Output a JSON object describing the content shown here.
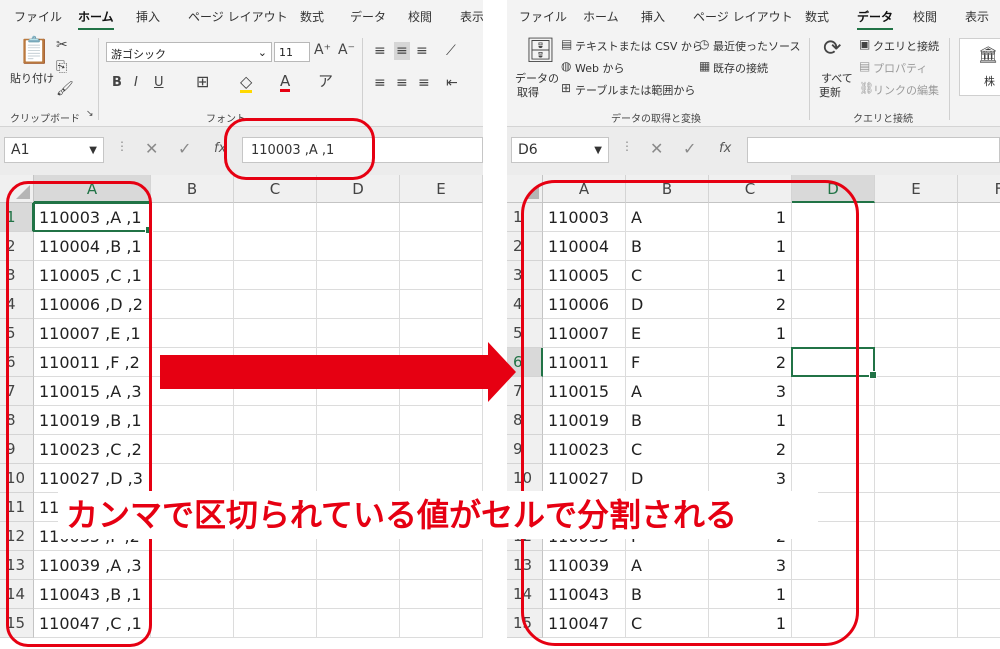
{
  "left": {
    "tabs": [
      "ファイル",
      "ホーム",
      "挿入",
      "ページ レイアウト",
      "数式",
      "データ",
      "校閲",
      "表示"
    ],
    "active_tab": "ホーム",
    "clipboard": {
      "paste": "貼り付け",
      "group": "クリップボード"
    },
    "font": {
      "name": "游ゴシック",
      "size": "11",
      "bold": "B",
      "italic": "I",
      "underline": "U",
      "group": "フォント"
    },
    "name_box": "A1",
    "formula": "110003 ,A ,1",
    "columns": [
      "A",
      "B",
      "C",
      "D",
      "E"
    ],
    "rows": [
      {
        "n": "1",
        "a": "110003 ,A ,1"
      },
      {
        "n": "2",
        "a": "110004 ,B ,1"
      },
      {
        "n": "3",
        "a": "110005 ,C ,1"
      },
      {
        "n": "4",
        "a": "110006 ,D ,2"
      },
      {
        "n": "5",
        "a": "110007 ,E ,1"
      },
      {
        "n": "6",
        "a": "110011 ,F ,2"
      },
      {
        "n": "7",
        "a": "110015 ,A ,3"
      },
      {
        "n": "8",
        "a": "110019 ,B ,1"
      },
      {
        "n": "9",
        "a": "110023 ,C ,2"
      },
      {
        "n": "10",
        "a": "110027 ,D ,3"
      },
      {
        "n": "11",
        "a": "11"
      },
      {
        "n": "12",
        "a": "110035 ,F ,2"
      },
      {
        "n": "13",
        "a": "110039 ,A ,3"
      },
      {
        "n": "14",
        "a": "110043 ,B ,1"
      },
      {
        "n": "15",
        "a": "110047 ,C ,1"
      }
    ]
  },
  "right": {
    "tabs": [
      "ファイル",
      "ホーム",
      "挿入",
      "ページ レイアウト",
      "数式",
      "データ",
      "校閲",
      "表示"
    ],
    "active_tab": "データ",
    "get_data": "データの\n取得",
    "get_data_line1": "データの",
    "get_data_line2": "取得",
    "from_text_csv": "テキストまたは CSV から",
    "from_web": "Web から",
    "from_table": "テーブルまたは範囲から",
    "recent_sources": "最近使ったソース",
    "existing_connections": "既存の接続",
    "group_get_transform": "データの取得と変換",
    "refresh_all_line1": "すべて",
    "refresh_all_line2": "更新",
    "queries_connections": "クエリと接続",
    "properties": "プロパティ",
    "edit_links": "リンクの編集",
    "group_queries": "クエリと接続",
    "stocks": "株",
    "name_box": "D6",
    "formula": "",
    "columns": [
      "A",
      "B",
      "C",
      "D",
      "E",
      "F"
    ],
    "rows": [
      {
        "n": "1",
        "a": "110003",
        "b": "A",
        "c": "1"
      },
      {
        "n": "2",
        "a": "110004",
        "b": "B",
        "c": "1"
      },
      {
        "n": "3",
        "a": "110005",
        "b": "C",
        "c": "1"
      },
      {
        "n": "4",
        "a": "110006",
        "b": "D",
        "c": "2"
      },
      {
        "n": "5",
        "a": "110007",
        "b": "E",
        "c": "1"
      },
      {
        "n": "6",
        "a": "110011",
        "b": "F",
        "c": "2"
      },
      {
        "n": "7",
        "a": "110015",
        "b": "A",
        "c": "3"
      },
      {
        "n": "8",
        "a": "110019",
        "b": "B",
        "c": "1"
      },
      {
        "n": "9",
        "a": "110023",
        "b": "C",
        "c": "2"
      },
      {
        "n": "10",
        "a": "110027",
        "b": "D",
        "c": "3"
      },
      {
        "n": "11",
        "a": "",
        "b": "",
        "c": ""
      },
      {
        "n": "12",
        "a": "110035",
        "b": "F",
        "c": "2"
      },
      {
        "n": "13",
        "a": "110039",
        "b": "A",
        "c": "3"
      },
      {
        "n": "14",
        "a": "110043",
        "b": "B",
        "c": "1"
      },
      {
        "n": "15",
        "a": "110047",
        "b": "C",
        "c": "1"
      }
    ]
  },
  "caption": "カンマで区切られている値がセルで分割される",
  "colors": {
    "accent": "#217346",
    "annotation": "#e60012"
  }
}
